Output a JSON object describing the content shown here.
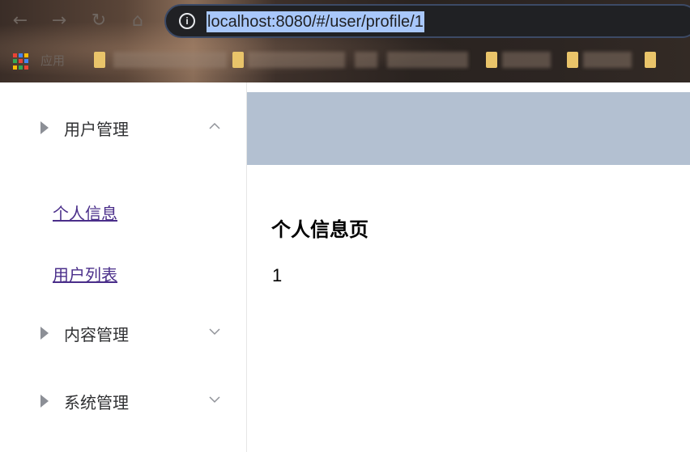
{
  "browser": {
    "url": "localhost:8080/#/user/profile/1",
    "bookmarks_apps_label": "应用",
    "icons": [
      "back-arrow-icon",
      "forward-arrow-icon",
      "reload-icon",
      "home-icon",
      "info-icon",
      "apps-grid-icon"
    ]
  },
  "sidebar": {
    "menus": [
      {
        "label": "用户管理",
        "expanded": true
      },
      {
        "label": "内容管理",
        "expanded": false
      },
      {
        "label": "系统管理",
        "expanded": false
      }
    ],
    "user_submenu": [
      {
        "label": "个人信息"
      },
      {
        "label": "用户列表"
      }
    ]
  },
  "main": {
    "header_color": "#b3c0d1",
    "title": "个人信息页",
    "value": "1"
  }
}
